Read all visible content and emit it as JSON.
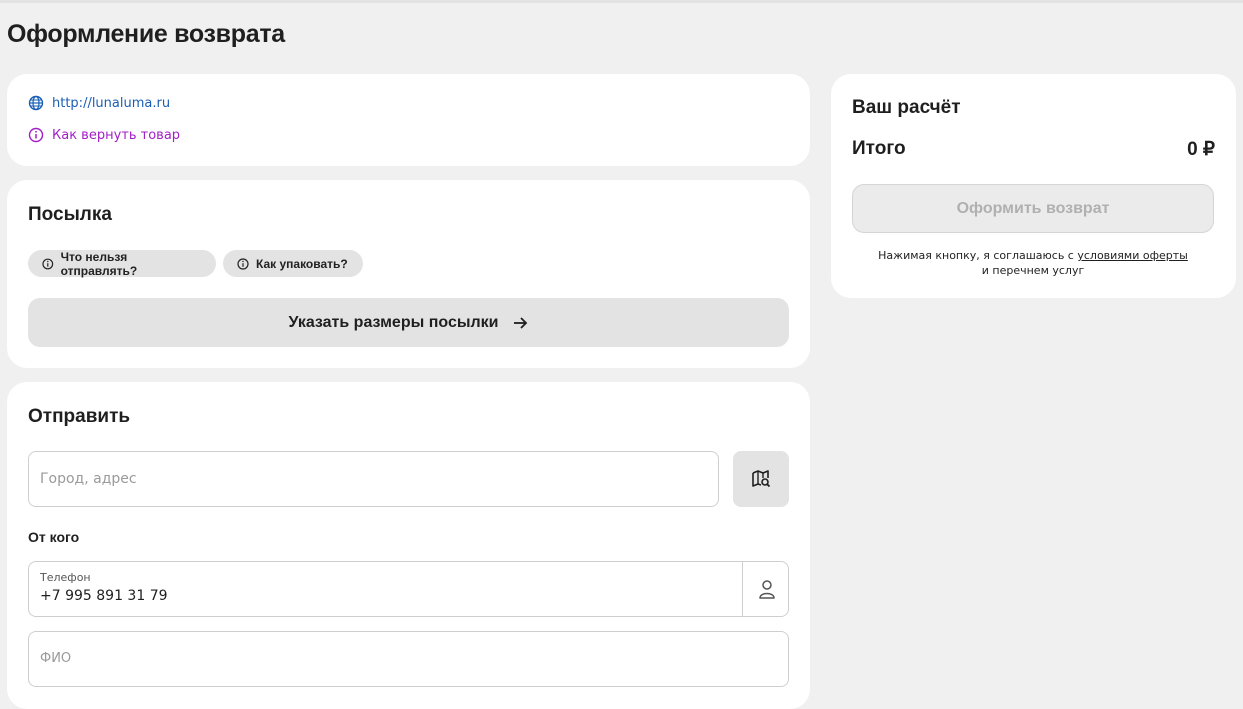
{
  "page": {
    "title": "Оформление возврата"
  },
  "links": {
    "site": "http://lunaluma.ru",
    "how_to_return": "Как вернуть товар"
  },
  "parcel": {
    "title": "Посылка",
    "chips": [
      "Что нельзя отправлять?",
      "Как упаковать?"
    ],
    "size_button": "Указать размеры посылки"
  },
  "send": {
    "title": "Отправить",
    "address_placeholder": "Город, адрес",
    "from_label": "От кого",
    "phone_label": "Телефон",
    "phone_value": "+7 995 891 31 79",
    "fio_placeholder": "ФИО"
  },
  "calc": {
    "title": "Ваш расчёт",
    "total_label": "Итого",
    "total_value": "0 ₽",
    "submit_label": "Оформить возврат",
    "consent_prefix": "Нажимая кнопку, я соглашаюсь с",
    "consent_link": "условиями оферты",
    "consent_suffix": "и перечнем услуг"
  },
  "colors": {
    "background": "#f0f0f0",
    "card": "#ffffff",
    "link_blue": "#1a5fb4",
    "link_purple": "#a21fc7",
    "button_gray": "#e3e3e3",
    "disabled_text": "#b0b0b0"
  },
  "icons": {
    "site": "globe-icon",
    "how_to_return": "info-icon",
    "chip": "info-icon",
    "size_button": "arrow-right-icon",
    "map": "map-search-icon",
    "contact": "person-icon"
  }
}
